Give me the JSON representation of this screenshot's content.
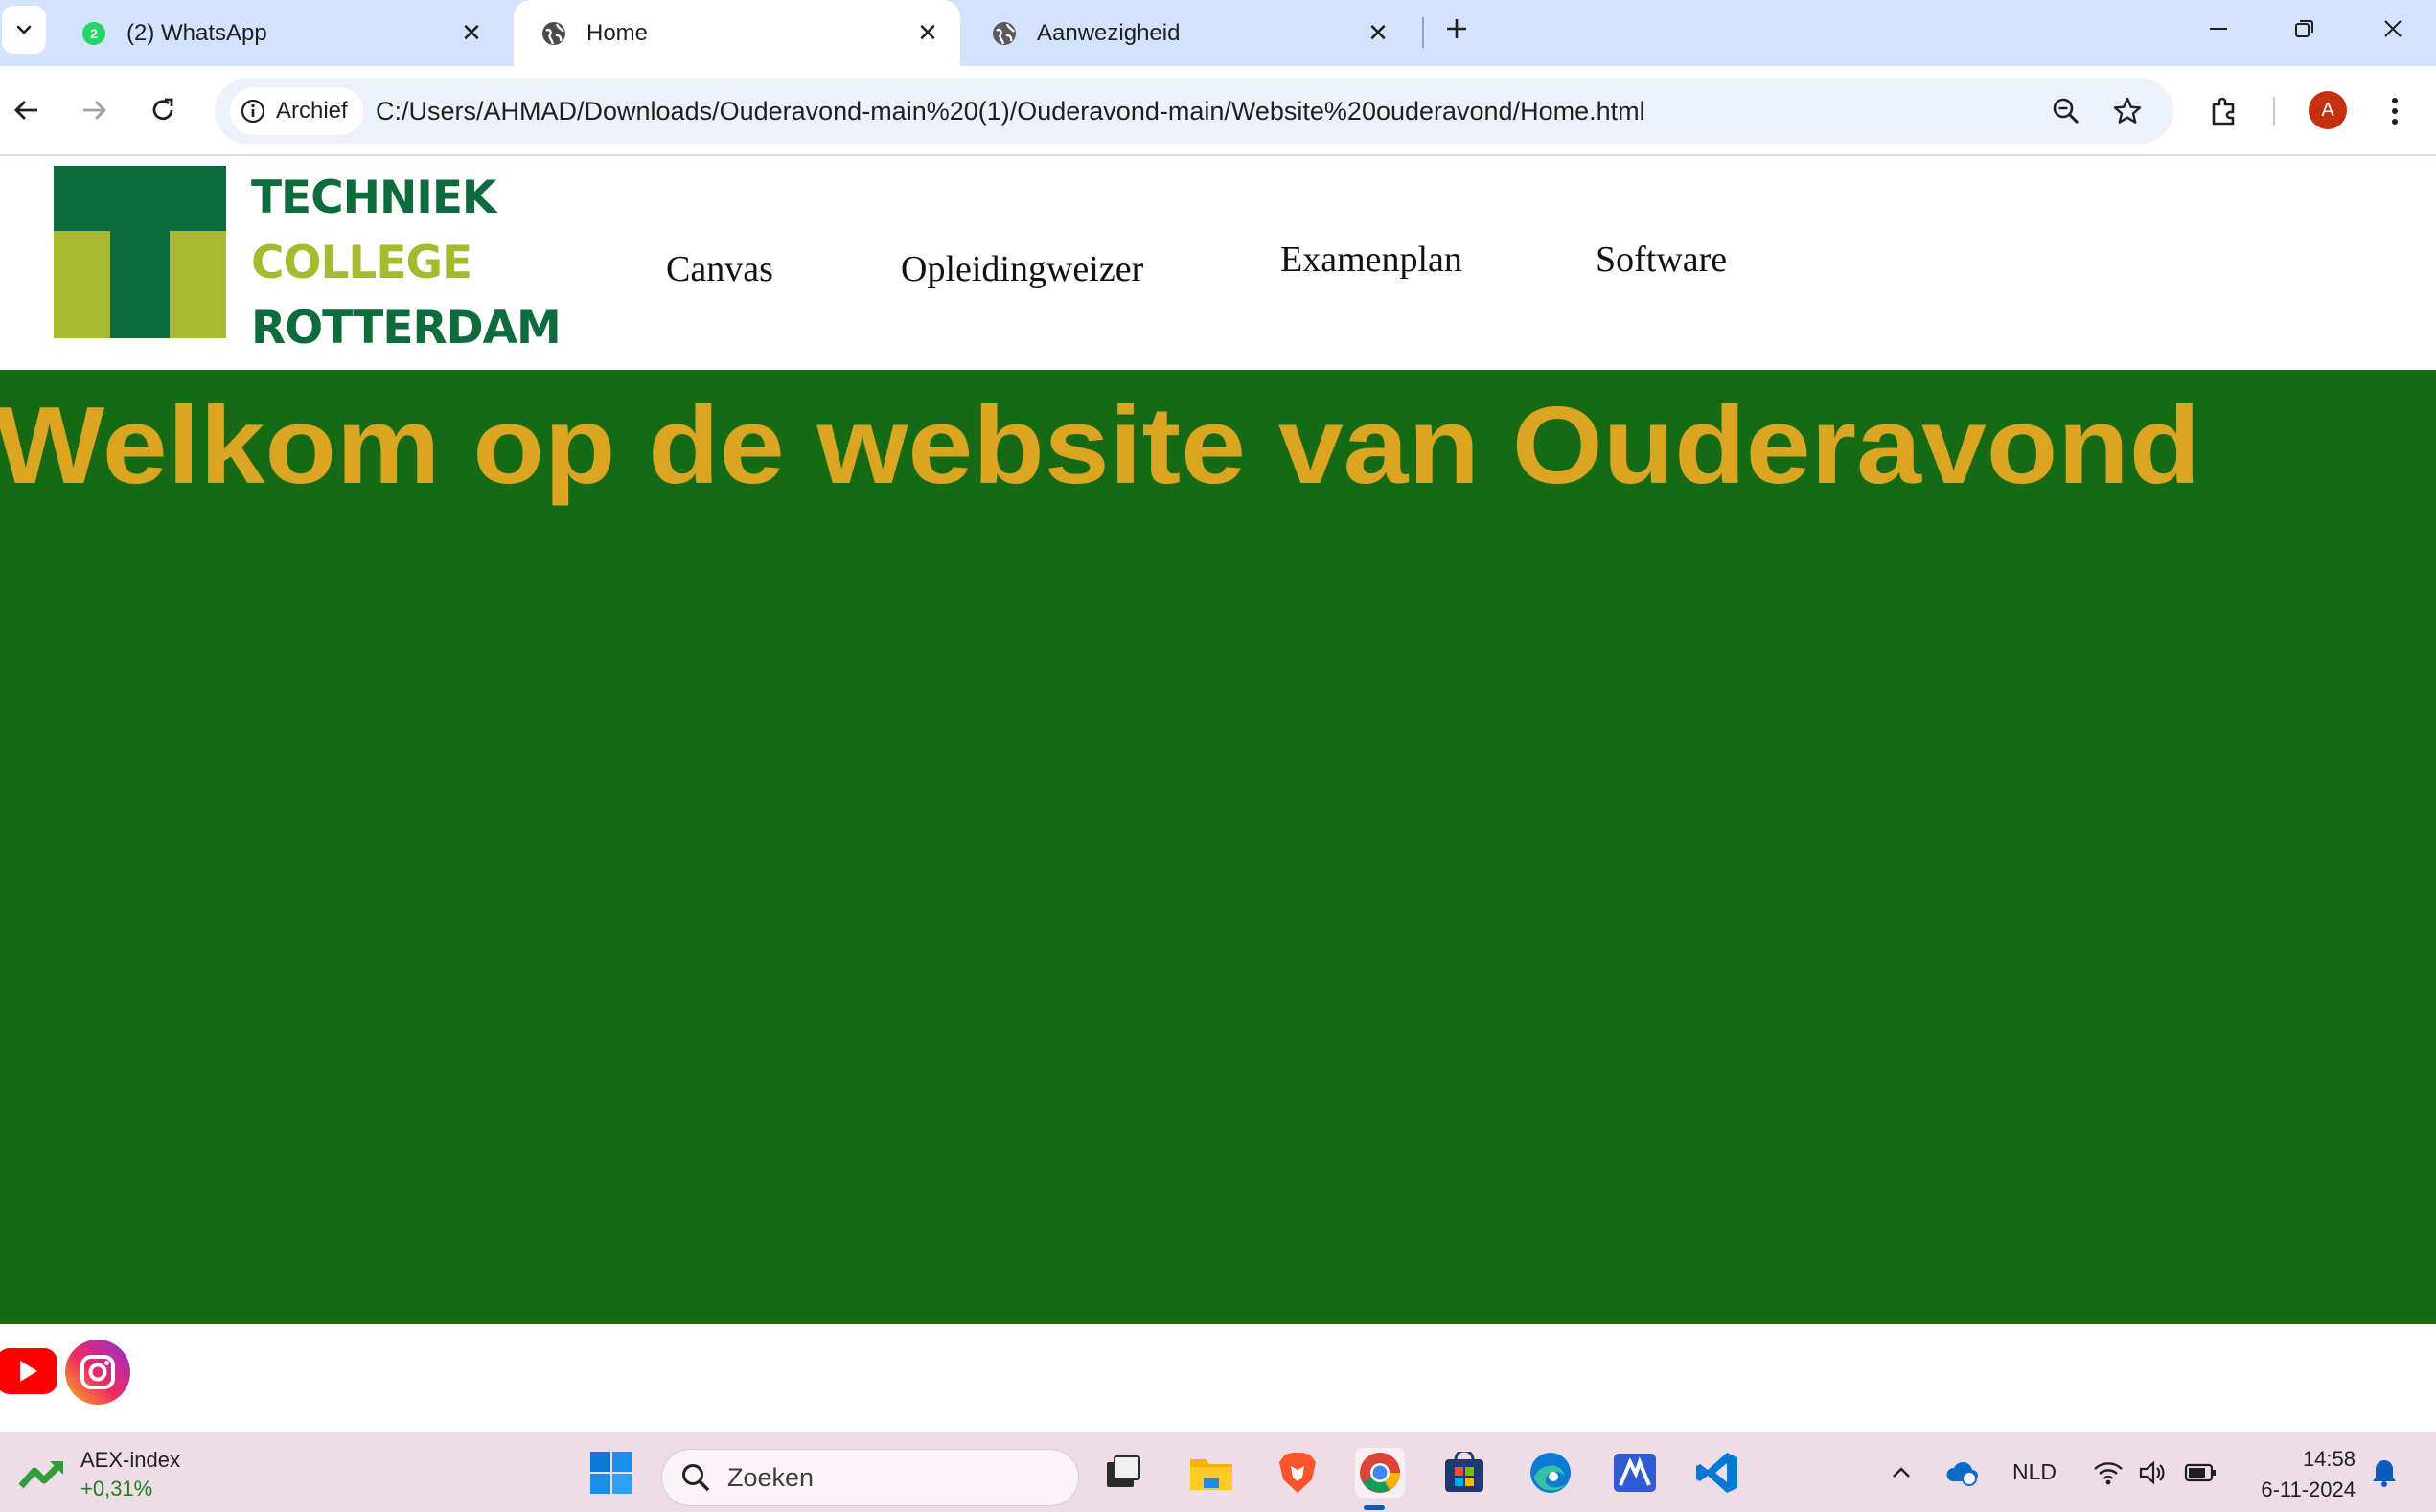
{
  "browser": {
    "tabs": [
      {
        "title": "(2) WhatsApp",
        "badge": "2",
        "active": false,
        "icon": "whatsapp-icon"
      },
      {
        "title": "Home",
        "active": true,
        "icon": "globe-icon"
      },
      {
        "title": "Aanwezigheid",
        "active": false,
        "icon": "globe-icon"
      }
    ],
    "address": {
      "security_chip": "Archief",
      "url": "C:/Users/AHMAD/Downloads/Ouderavond-main%20(1)/Ouderavond-main/Website%20ouderavond/Home.html"
    },
    "profile_initial": "A"
  },
  "site": {
    "logo": {
      "line1": "TECHNIEK",
      "line2": "COLLEGE",
      "line3": "ROTTERDAM"
    },
    "nav": [
      "Canvas",
      "Opleidingweizer",
      "Examenplan",
      "Software"
    ],
    "hero_title": "Welkom op de website van Ouderavond",
    "social": [
      "youtube-icon",
      "instagram-icon"
    ]
  },
  "taskbar": {
    "widget": {
      "label": "AEX-index",
      "change": "+0,31%"
    },
    "search_placeholder": "Zoeken",
    "language": "NLD",
    "time": "14:58",
    "date": "6-11-2024"
  },
  "colors": {
    "hero_bg": "#176a14",
    "hero_text": "#daa520",
    "logo_green": "#0e6b3c",
    "logo_lime": "#a6ba2f",
    "tabstrip": "#d3e3fd"
  }
}
